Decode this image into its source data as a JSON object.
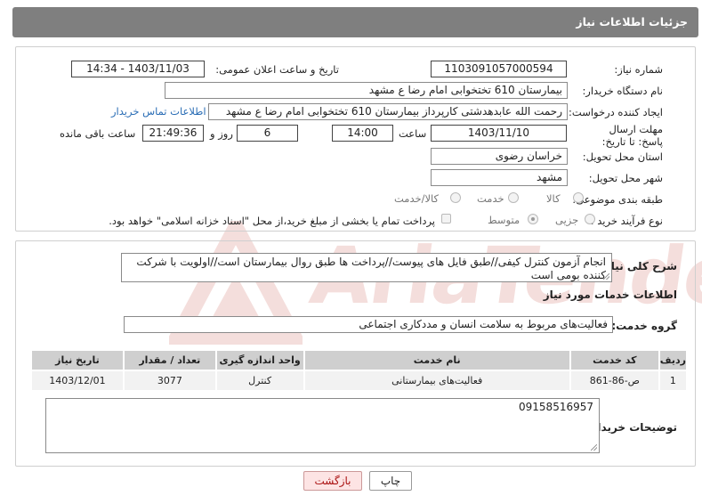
{
  "header": {
    "title": "جزئیات اطلاعات نیاز"
  },
  "fields": {
    "need_number_label": "شماره نیاز:",
    "need_number": "1103091057000594",
    "announce_label": "تاریخ و ساعت اعلان عمومی:",
    "announce_value": "1403/11/03 - 14:34",
    "buyer_label": "نام دستگاه خریدار:",
    "buyer_value": "بیمارستان 610 تختخوابی امام رضا ع  مشهد",
    "creator_label": "ایجاد کننده درخواست:",
    "creator_value": "رحمت الله عابدهدشتی کارپرداز بیمارستان 610 تختخوابی امام رضا ع  مشهد",
    "contact_link": "اطلاعات تماس خریدار",
    "deadline_label": "مهلت ارسال پاسخ: تا تاریخ:",
    "deadline_date": "1403/11/10",
    "time_label": "ساعت",
    "deadline_time": "14:00",
    "days_value": "6",
    "days_label": "روز و",
    "remaining_time": "21:49:36",
    "remaining_label": "ساعت باقی مانده",
    "province_label": "استان محل تحویل:",
    "province_value": "خراسان رضوی",
    "city_label": "شهر محل تحویل:",
    "city_value": "مشهد",
    "category_label": "طبقه بندی موضوعی:",
    "category_options": [
      "کالا",
      "خدمت",
      "کالا/خدمت"
    ],
    "process_label": "نوع فرآیند خرید :",
    "process_options": [
      "جزیی",
      "متوسط"
    ],
    "payment_note": "پرداخت تمام یا بخشی از مبلغ خرید،از محل \"اسناد خزانه اسلامی\" خواهد بود."
  },
  "summary": {
    "label": "شرح کلی نیاز:",
    "text": "انجام آزمون کنترل کیفی//طبق فایل های پیوست//پرداخت ها طبق روال بیمارستان است//اولویت با شرکت کننده بومی است"
  },
  "services": {
    "section_title": "اطلاعات خدمات مورد نیاز",
    "group_label": "گروه خدمت:",
    "group_value": "فعالیت‌های مربوط به سلامت انسان و مددکاری اجتماعی",
    "columns": [
      "ردیف",
      "کد خدمت",
      "نام خدمت",
      "واحد اندازه گیری",
      "تعداد / مقدار",
      "تاریخ نیاز"
    ],
    "rows": [
      [
        "1",
        "ص-86-861",
        "فعالیت‌های بیمارستانی",
        "کنترل",
        "3077",
        "1403/12/01"
      ]
    ]
  },
  "buyer_notes": {
    "label": "توضیحات خریدار:",
    "text": "09158516957"
  },
  "buttons": {
    "print": "چاپ",
    "back": "بازگشت"
  },
  "watermark": {
    "text": "AriaTender.net"
  }
}
